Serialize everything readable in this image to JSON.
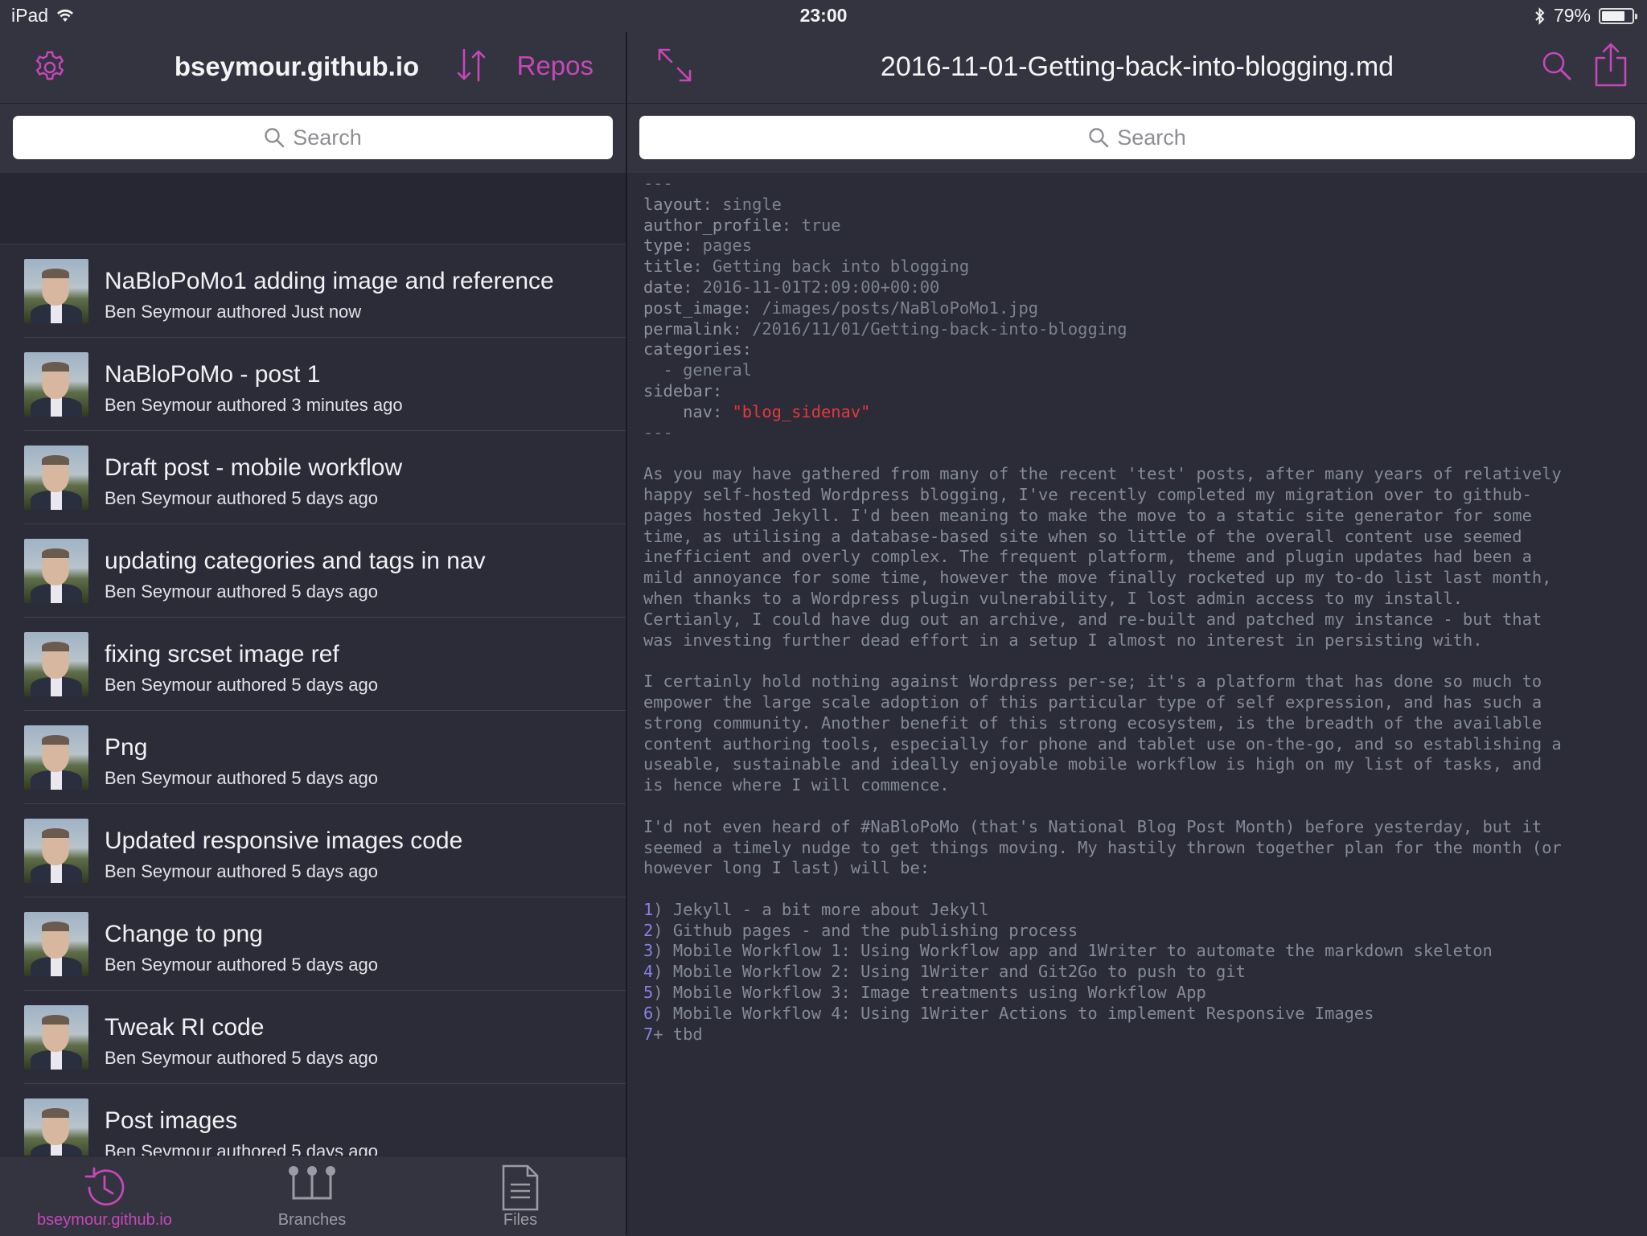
{
  "status_bar": {
    "device": "iPad",
    "time": "23:00",
    "battery": "79%",
    "battery_level": 0.79
  },
  "left_nav": {
    "title": "bseymour.github.io",
    "repos_label": "Repos"
  },
  "left_search": {
    "placeholder": "Search"
  },
  "commits": [
    {
      "message": "NaBloPoMo1 adding image and reference",
      "meta": "Ben Seymour authored Just now"
    },
    {
      "message": "NaBloPoMo - post 1",
      "meta": "Ben Seymour authored 3 minutes ago"
    },
    {
      "message": "Draft post - mobile workflow",
      "meta": "Ben Seymour authored 5 days ago"
    },
    {
      "message": "updating categories and tags in nav",
      "meta": "Ben Seymour authored 5 days ago"
    },
    {
      "message": "fixing srcset image ref",
      "meta": "Ben Seymour authored 5 days ago"
    },
    {
      "message": "Png",
      "meta": "Ben Seymour authored 5 days ago"
    },
    {
      "message": "Updated responsive images code",
      "meta": "Ben Seymour authored 5 days ago"
    },
    {
      "message": "Change to png",
      "meta": "Ben Seymour authored 5 days ago"
    },
    {
      "message": "Tweak RI code",
      "meta": "Ben Seymour authored 5 days ago"
    },
    {
      "message": "Post images",
      "meta": "Ben Seymour authored 5 days ago"
    }
  ],
  "tab_bar": {
    "tabs": [
      {
        "label": "bseymour.github.io",
        "active": true
      },
      {
        "label": "Branches",
        "active": false
      },
      {
        "label": "Files",
        "active": false
      }
    ]
  },
  "right_nav": {
    "title": "2016-11-01-Getting-back-into-blogging.md"
  },
  "right_search": {
    "placeholder": "Search"
  },
  "file": {
    "front_matter": {
      "open": "---",
      "layout": [
        "layout",
        "single"
      ],
      "author_profile": [
        "author_profile",
        "true"
      ],
      "type": [
        "type",
        "pages"
      ],
      "title": [
        "title",
        "Getting back into blogging"
      ],
      "date": [
        "date",
        "2016-11-01T2:09:00+00:00"
      ],
      "post_image": [
        "post_image",
        "/images/posts/NaBloPoMo1.jpg"
      ],
      "permalink": [
        "permalink",
        "/2016/11/01/Getting-back-into-blogging"
      ],
      "categories": "categories:",
      "category_item": "  - general",
      "sidebar": "sidebar:",
      "nav_key": "    nav",
      "nav_value": "\"blog_sidenav\"",
      "close": "---"
    },
    "paragraph_1": [
      "As you may have gathered from many of the recent 'test' posts, after many years of relatively",
      "happy self-hosted Wordpress blogging, I've recently completed my migration over to github-",
      "pages hosted Jekyll. I'd been meaning to make the move to a static site generator for some",
      "time, as utilising a database-based site when so little of the overall content use seemed",
      "inefficient and overly complex. The frequent platform, theme and plugin updates had been a",
      "mild annoyance for some time, however the move finally rocketed up my to-do list last month,",
      "when thanks to a Wordpress plugin vulnerability, I lost admin access to my install.",
      "Certianly, I could have dug out an archive, and re-built and patched my instance - but that",
      "was investing further dead effort in a setup I almost no interest in persisting with."
    ],
    "paragraph_2": [
      "I certainly hold nothing against Wordpress per-se; it's a platform that has done so much to",
      "empower the large scale adoption of this particular type of self expression, and has such a",
      "strong community. Another benefit of this strong ecosystem, is the breadth of the available",
      "content authoring tools, especially for phone and tablet use on-the-go, and so establishing a",
      "useable, sustainable and ideally enjoyable mobile workflow is high on my list of tasks, and",
      "is hence where I will commence."
    ],
    "paragraph_3": [
      "I'd not even heard of #NaBloPoMo (that's National Blog Post Month) before yesterday, but it",
      "seemed a timely nudge to get things moving. My hastily thrown together plan for the month (or",
      "however long I last) will be:"
    ],
    "list": [
      [
        "1",
        ") Jekyll - a bit more about Jekyll"
      ],
      [
        "2",
        ") Github pages - and the publishing process"
      ],
      [
        "3",
        ") Mobile Workflow 1: Using Workflow app and 1Writer to automate the markdown skeleton"
      ],
      [
        "4",
        ") Mobile Workflow 2: Using 1Writer and Git2Go to push to git"
      ],
      [
        "5",
        ") Mobile Workflow 3: Image treatments using Workflow App"
      ],
      [
        "6",
        ") Mobile Workflow 4: Using 1Writer Actions to implement Responsive Images"
      ],
      [
        "7",
        "+ tbd"
      ]
    ]
  },
  "colors": {
    "accent": "#c548b8",
    "background": "#2b2c38",
    "bar": "#33343f",
    "number": "#8a7fe6",
    "string": "#e5383b"
  },
  "icons": {
    "settings": "gear-icon",
    "sort": "sort-arrows-icon",
    "expand": "expand-icon",
    "search": "search-icon",
    "share": "share-icon",
    "history": "clock-history-icon",
    "branches": "branches-icon",
    "files": "document-icon"
  }
}
